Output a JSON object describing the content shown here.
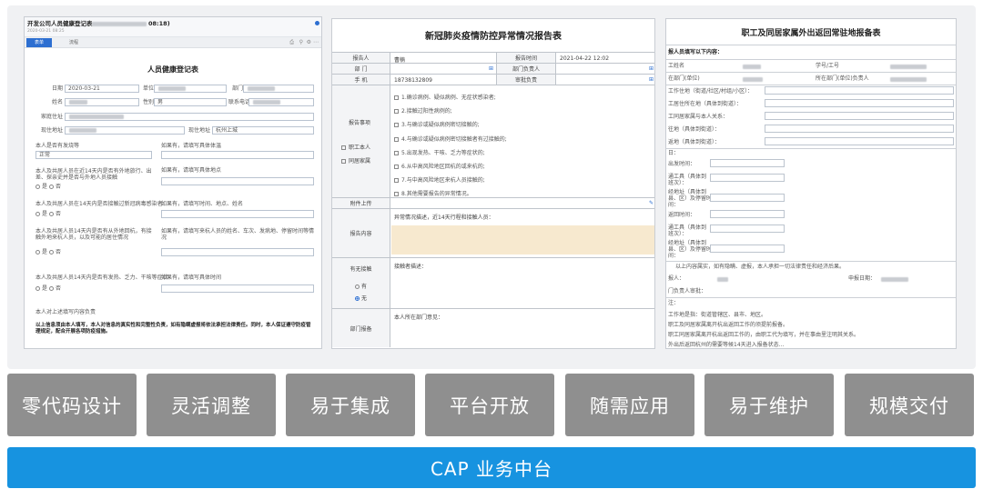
{
  "doc1": {
    "header_title": "开发公司人员健康登记表",
    "header_time": "08:18)",
    "header_sub": "2020-03-21 08:25",
    "tabs": [
      "表单",
      "流程"
    ],
    "form_title": "人员健康登记表",
    "rows": [
      {
        "label": "日期",
        "value": "2020-03-21",
        "label2": "单位",
        "label3": "部门"
      },
      {
        "label": "姓名",
        "label2": "性别",
        "value2": "男",
        "label3": "联系电话"
      },
      {
        "label": "家庭住址"
      },
      {
        "label": "现住地址",
        "label2": "现住地址",
        "value2": "杭州上城"
      }
    ],
    "questions": [
      {
        "q": "本人是否有发烧等",
        "q2": "如果有，请填写具体体温",
        "answer": "正常"
      },
      {
        "q": "本人及共居人员在近14天内是否有外地旅行、出差、探亲史并是否与外地人员接触",
        "q2": "如果有，请填写具体地点",
        "options": [
          "是",
          "否"
        ]
      },
      {
        "q": "本人及共居人员在14天内是否接触过新冠病毒感染者",
        "q2": "如果有，请填写时间、地点、姓名",
        "options": [
          "是",
          "否"
        ]
      },
      {
        "q": "本人及共居人员14天内是否有从外地回杭，有接触外地来杭人员，以及可能的居住情况",
        "q2": "如果有，请填写来杭人员的姓名、车次、发病地、停留时间等情况",
        "options": [
          "是",
          "否"
        ]
      },
      {
        "q": "本人及共居人员14天内是否有发热、乏力、干咳等症状",
        "q2": "如果有，请填写具体时间",
        "options": [
          "是",
          "否"
        ]
      }
    ],
    "footer_note": "本人对上述填写内容负责",
    "footer_bold": "以上信息须由本人填写，本人对信息的真实性和完整性负责，如有隐瞒虚报将依法承担法律责任。同时，本人保证遵守防疫管理规定，配合开展各项防疫措施。"
  },
  "doc2": {
    "title": "新冠肺炎疫情防控异常情况报告表",
    "reporter_label": "报告人",
    "reporter_value": "曹楠",
    "report_time_label": "报告时间",
    "report_time_value": "2021-04-22 12:02",
    "dept_label": "部 门",
    "dept_head_label": "部门负责人",
    "phone_label": "手 机",
    "phone_value": "18738132809",
    "approver_label": "审批负责",
    "items_label": "报告事项",
    "self_label": "职工本人",
    "family_label": "同居家属",
    "items": [
      "1.确诊病例、疑似病例、无症状感染者;",
      "2.接触过阳性病例的;",
      "3.与确诊或疑似病例密切接触的;",
      "4.与确诊或疑似病例密切接触者有过接触的;",
      "5.出现发热、干咳、乏力等症状的;",
      "6.从中高风险地区回杭的或来杭的;",
      "7.与中高风险地区来杭人员接触的;",
      "8.其他需要报告的异常情况。"
    ],
    "attach_label": "附件上传",
    "content_label": "报告内容",
    "content_hint": "异常情况描述，近14天行程和接触人员：",
    "contact_label": "有无接触",
    "contact_hint": "接触者描述：",
    "options": [
      "有",
      "无"
    ],
    "dept_report_label": "部门报备",
    "dept_report_hint": "本人所在部门意见："
  },
  "doc3": {
    "title": "职工及同居家属外出返回常驻地报备表",
    "section_label": "报人员填写以下内容：",
    "row1": [
      "工姓名",
      "学号/工号"
    ],
    "row2": [
      "在部门(单位)",
      "所在部门(单位)负责人"
    ],
    "fields": [
      "工作住地（街道/社区/村组/小区）：",
      "工居住所在地（具体到街道）：",
      "工同居家属与本人关系：",
      "往地（具体到街道）：",
      "返地（具体到街道）："
    ],
    "trip_labels": [
      "日：",
      "出发时间：",
      "通工具（具体到\n班次）：",
      "经地址（具体到\n县、区）及停留时\n间：",
      "返回时间：",
      "通工具（具体到\n班次）：",
      "经地址（具体到\n县、区）及停留时\n间："
    ],
    "promise": "以上内容属实，如有隐瞒、虚报，本人承担一切法律责任和经济后果。",
    "sign_label": "报人：",
    "date_label": "申报日期：",
    "leader_label": "门负责人审批：",
    "notes_title": "注：",
    "notes": [
      "工作地是指：街道管辖区、县市、地区。",
      "职工及同居家属离开杭出返回工作的须提前报备。",
      "职工同居家属离开杭出返回工作的，由职工代为填写，并在事由里注明其关系。",
      "外出后返回杭州的需要等候14天进入报备状态…"
    ]
  },
  "features": [
    "零代码设计",
    "灵活调整",
    "易于集成",
    "平台开放",
    "随需应用",
    "易于维护",
    "规模交付"
  ],
  "platform": "CAP 业务中台",
  "colors": {
    "feature_bg": "#8f8f8f",
    "platform_bg": "#1793e0",
    "tab_active": "#2d6fd1",
    "highlight": "#f7e9cf"
  }
}
